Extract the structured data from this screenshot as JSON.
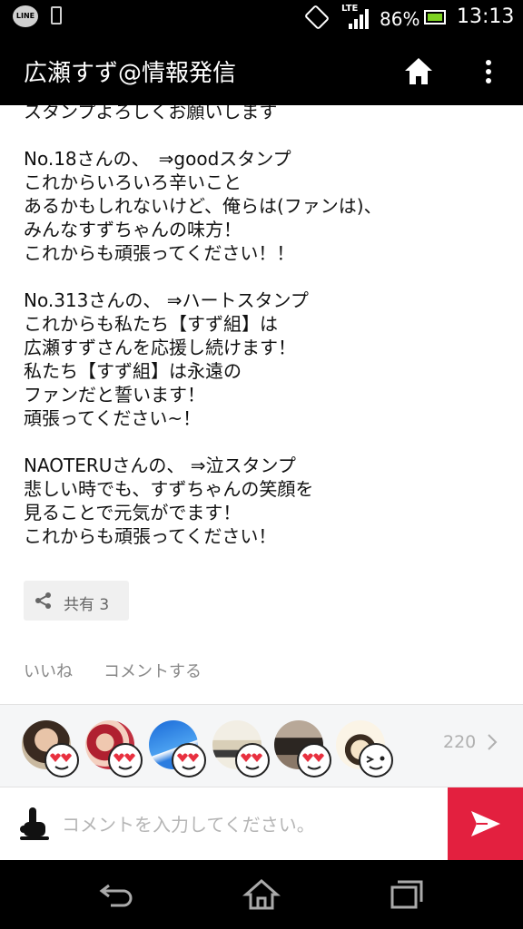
{
  "status_bar": {
    "line_badge": "LINE",
    "network": "LTE",
    "battery": "86%",
    "time": "13:13"
  },
  "app_bar": {
    "title": "広瀬すず@情報発信",
    "icons": [
      "home-icon",
      "more-vert-icon"
    ]
  },
  "post": {
    "lines": [
      "スタンプよろしくお願いします",
      "",
      "No.18さんの、　⇒goodスタンプ",
      "これからいろいろ辛いこと",
      "あるかもしれないけど、俺らは(ファンは)、",
      "みんなすずちゃんの味方！",
      "これからも頑張ってください！！",
      "",
      "No.313さんの、 ⇒ハートスタンプ",
      "これからも私たち【すず組】は",
      "広瀬すずさんを応援し続けます！",
      "私たち【すず組】は永遠の",
      "ファンだと誓います！",
      "頑張ってください~！",
      "",
      "NAOTERUさんの、 ⇒泣スタンプ",
      "悲しい時でも、すずちゃんの笑顔を",
      "見ることで元気がでます！",
      "これからも頑張ってください！"
    ],
    "share_label": "共有 3",
    "like_label": "いいね",
    "comment_label": "コメントする"
  },
  "reactions": {
    "reaction_type": "heart-eyes",
    "count": "220",
    "users": [
      "user-1",
      "user-2",
      "user-3",
      "user-4",
      "user-5",
      "user-6"
    ]
  },
  "comment_box": {
    "placeholder": "コメントを入力してください。"
  },
  "colors": {
    "bar": "#000000",
    "accent_send": "#e3203f",
    "heart": "#e8303f"
  }
}
